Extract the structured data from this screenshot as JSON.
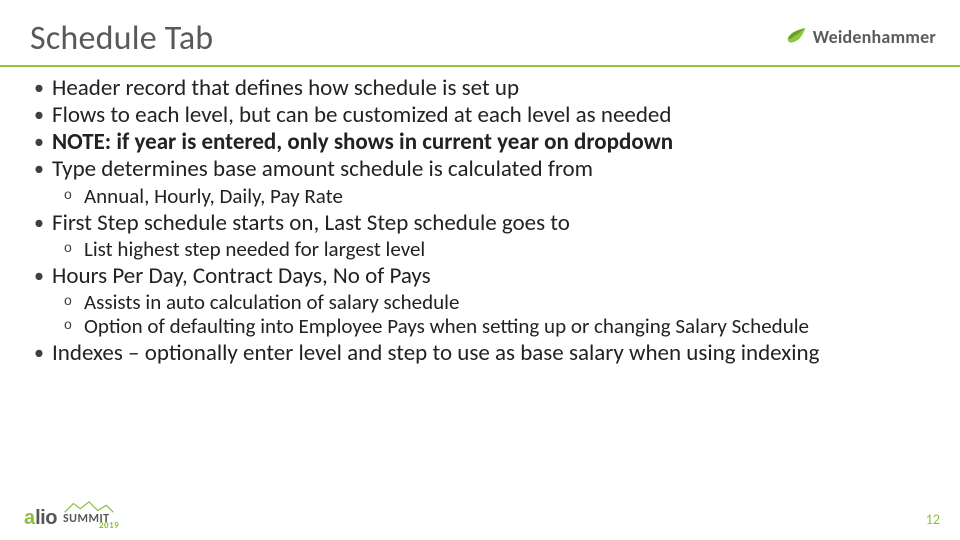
{
  "title": "Schedule Tab",
  "brand": {
    "name": "Weidenhammer"
  },
  "bullets": {
    "b1": "Header record that defines how schedule is set up",
    "b2": "Flows to each level, but can be customized at each level as needed",
    "b3": "NOTE: if year is entered, only shows in current year on dropdown",
    "b4": "Type determines base amount schedule is calculated from",
    "b4_sub1": "Annual, Hourly, Daily, Pay Rate",
    "b5": "First Step schedule starts on, Last Step schedule goes to",
    "b5_sub1": "List highest step needed for largest level",
    "b6": "Hours Per Day, Contract Days, No of Pays",
    "b6_sub1": "Assists in auto calculation of salary schedule",
    "b6_sub2": "Option of defaulting into Employee Pays when setting up or changing Salary Schedule",
    "b7": "Indexes – optionally enter level and step to use as base salary when using indexing"
  },
  "footer": {
    "logo_prefix": "a",
    "logo_rest": "lio",
    "logo_word": "SUMMIT",
    "logo_year": "2019",
    "page": "12"
  },
  "colors": {
    "accent": "#8ec63f",
    "title": "#595959"
  }
}
